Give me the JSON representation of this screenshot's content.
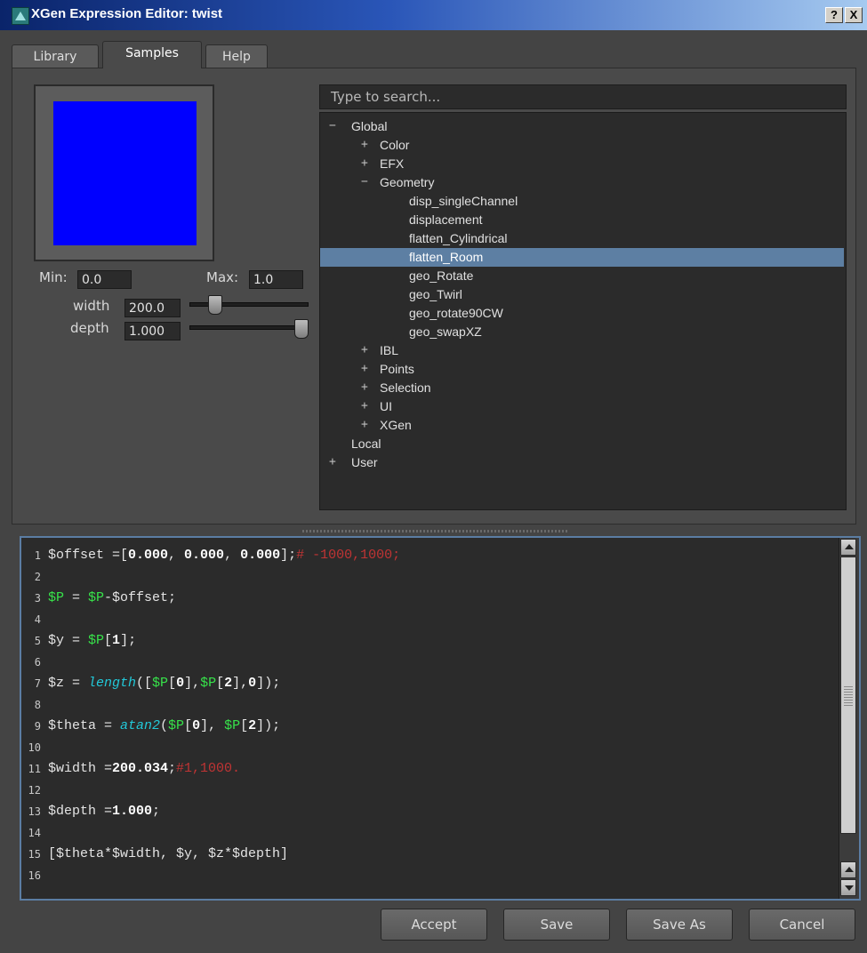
{
  "window": {
    "title": "XGen Expression Editor: twist",
    "help_glyph": "?",
    "close_glyph": "X"
  },
  "tabs": [
    {
      "label": "Library"
    },
    {
      "label": "Samples",
      "active": true
    },
    {
      "label": "Help"
    }
  ],
  "preview": {
    "swatch_color": "#0000ff",
    "min_label": "Min:",
    "min_value": "0.0",
    "max_label": "Max:",
    "max_value": "1.0",
    "params": [
      {
        "label": "width",
        "value": "200.0"
      },
      {
        "label": "depth",
        "value": "1.000"
      }
    ]
  },
  "search": {
    "placeholder": "Type to search..."
  },
  "tree": {
    "nodes": [
      {
        "label": "Global",
        "exp": "−"
      },
      {
        "label": "Color",
        "exp": "+"
      },
      {
        "label": "EFX",
        "exp": "+"
      },
      {
        "label": "Geometry",
        "exp": "−"
      },
      {
        "label": "disp_singleChannel",
        "exp": ""
      },
      {
        "label": "displacement",
        "exp": ""
      },
      {
        "label": "flatten_Cylindrical",
        "exp": ""
      },
      {
        "label": "flatten_Room",
        "exp": "",
        "selected": true
      },
      {
        "label": "geo_Rotate",
        "exp": ""
      },
      {
        "label": "geo_Twirl",
        "exp": ""
      },
      {
        "label": "geo_rotate90CW",
        "exp": ""
      },
      {
        "label": "geo_swapXZ",
        "exp": ""
      },
      {
        "label": "IBL",
        "exp": "+"
      },
      {
        "label": "Points",
        "exp": "+"
      },
      {
        "label": "Selection",
        "exp": "+"
      },
      {
        "label": "UI",
        "exp": "+"
      },
      {
        "label": "XGen",
        "exp": "+"
      },
      {
        "label": "Local",
        "exp": ""
      },
      {
        "label": "User",
        "exp": "+"
      }
    ]
  },
  "editor": {
    "line_numbers": [
      "1",
      "2",
      "3",
      "4",
      "5",
      "6",
      "7",
      "8",
      "9",
      "10",
      "11",
      "12",
      "13",
      "14",
      "15",
      "16"
    ],
    "code": {
      "l1": {
        "a": "$offset =[",
        "n1": "0.000",
        "s1": ", ",
        "n2": "0.000",
        "s2": ", ",
        "n3": "0.000",
        "b": "];",
        "c": "# -1000,1000;"
      },
      "l3": {
        "v1": "$P",
        "a": " = ",
        "v2": "$P",
        "b": "-$offset;"
      },
      "l5": {
        "a": "$y = ",
        "v": "$P",
        "b": "[",
        "n": "1",
        "c": "];"
      },
      "l7": {
        "a": "$z = ",
        "fn": "length",
        "b": "([",
        "v1": "$P",
        "c": "[",
        "n1": "0",
        "d": "],",
        "v2": "$P",
        "e": "[",
        "n2": "2",
        "f": "],",
        "n3": "0",
        "g": "]);"
      },
      "l9": {
        "a": "$theta = ",
        "fn": "atan2",
        "b": "(",
        "v1": "$P",
        "c": "[",
        "n1": "0",
        "d": "], ",
        "v2": "$P",
        "e": "[",
        "n2": "2",
        "f": "]);"
      },
      "l11": {
        "a": "$width =",
        "n": "200.034",
        "b": ";",
        "c": "#1,1000."
      },
      "l13": {
        "a": "$depth =",
        "n": "1.000",
        "b": ";"
      },
      "l15": {
        "a": "[$theta*$width, $y, $z*$depth]"
      }
    }
  },
  "buttons": {
    "accept": "Accept",
    "save": "Save",
    "save_as": "Save As",
    "cancel": "Cancel"
  }
}
